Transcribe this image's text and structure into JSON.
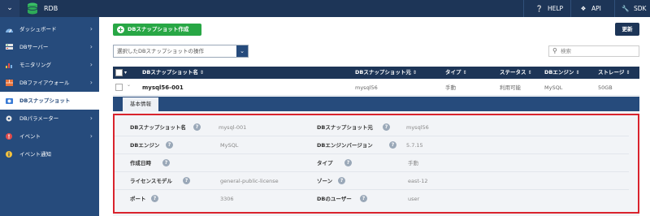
{
  "app": {
    "title": "RDB",
    "menu_icon": "chevron-down-icon",
    "logo_icon": "database-icon"
  },
  "header": {
    "help": "HELP",
    "api": "API",
    "sdk": "SDK"
  },
  "sidebar": {
    "items": [
      {
        "label": "ダッシュボード",
        "icon": "dashboard-icon"
      },
      {
        "label": "DBサーバー",
        "icon": "db-server-icon"
      },
      {
        "label": "モニタリング",
        "icon": "monitoring-icon"
      },
      {
        "label": "DBファイアウォール",
        "icon": "firewall-icon"
      },
      {
        "label": "DBスナップショット",
        "icon": "snapshot-icon",
        "active": true
      },
      {
        "label": "DBパラメーター",
        "icon": "parameter-icon"
      },
      {
        "label": "イベント",
        "icon": "event-icon"
      },
      {
        "label": "イベント通知",
        "icon": "event-notify-icon"
      }
    ]
  },
  "toolbar": {
    "create_label": "DBスナップショット作成",
    "refresh_label": "更新",
    "select_label": "選択したDBスナップショットの操作",
    "search_placeholder": "検索"
  },
  "table": {
    "columns": [
      "DBスナップショット名",
      "DBスナップショット元",
      "タイプ",
      "ステータス",
      "DBエンジン",
      "ストレージ"
    ],
    "rows": [
      {
        "name": "mysql56-001",
        "source": "mysql56",
        "type": "手動",
        "status": "利用可能",
        "engine": "MySQL",
        "storage": "50GB"
      }
    ]
  },
  "detail": {
    "tab_label": "基本情報",
    "fields": [
      {
        "label": "DBスナップショット名",
        "value": "mysql-001"
      },
      {
        "label": "DBスナップショット元",
        "value": "mysql56"
      },
      {
        "label": "DBエンジン",
        "value": "MySQL"
      },
      {
        "label": "DBエンジンバージョン",
        "value": "5.7.15"
      },
      {
        "label": "作成日時",
        "value": ""
      },
      {
        "label": "タイプ",
        "value": "手動"
      },
      {
        "label": "ライセンスモデル",
        "value": "general-public-license"
      },
      {
        "label": "ゾーン",
        "value": "east-12"
      },
      {
        "label": "ポート",
        "value": "3306"
      },
      {
        "label": "DBのユーザー",
        "value": "user"
      }
    ]
  },
  "colors": {
    "topbar": "#1d3557",
    "sidebar": "#264b7c",
    "create_button": "#28a745",
    "highlight_border": "#d9232d"
  }
}
